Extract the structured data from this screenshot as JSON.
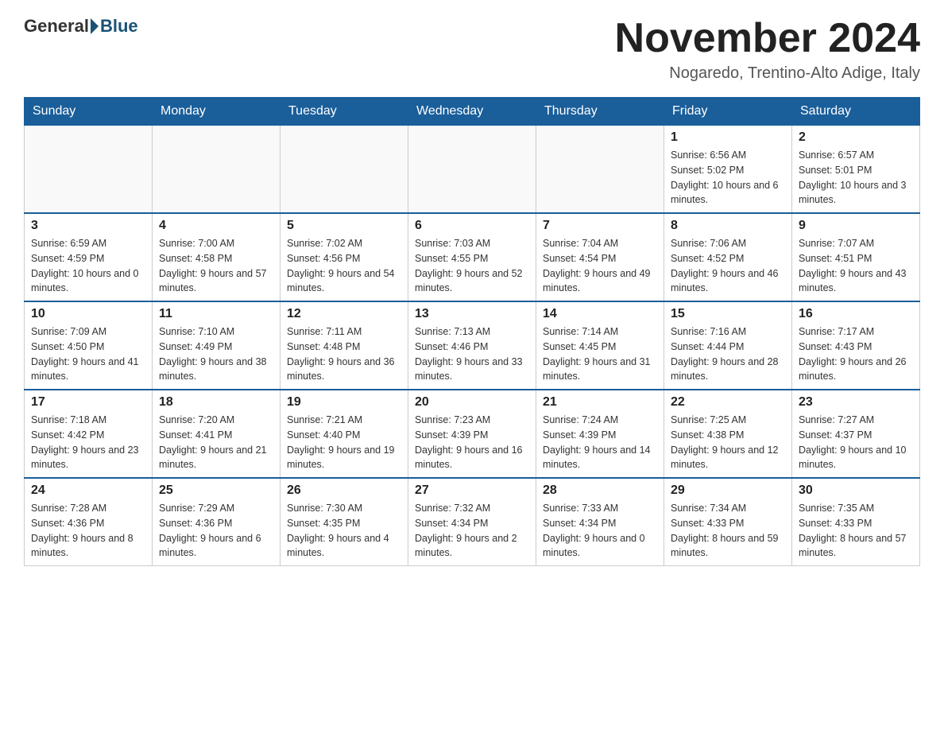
{
  "header": {
    "logo_general": "General",
    "logo_blue": "Blue",
    "month_year": "November 2024",
    "location": "Nogaredo, Trentino-Alto Adige, Italy"
  },
  "weekdays": [
    "Sunday",
    "Monday",
    "Tuesday",
    "Wednesday",
    "Thursday",
    "Friday",
    "Saturday"
  ],
  "weeks": [
    [
      {
        "day": "",
        "info": ""
      },
      {
        "day": "",
        "info": ""
      },
      {
        "day": "",
        "info": ""
      },
      {
        "day": "",
        "info": ""
      },
      {
        "day": "",
        "info": ""
      },
      {
        "day": "1",
        "info": "Sunrise: 6:56 AM\nSunset: 5:02 PM\nDaylight: 10 hours and 6 minutes."
      },
      {
        "day": "2",
        "info": "Sunrise: 6:57 AM\nSunset: 5:01 PM\nDaylight: 10 hours and 3 minutes."
      }
    ],
    [
      {
        "day": "3",
        "info": "Sunrise: 6:59 AM\nSunset: 4:59 PM\nDaylight: 10 hours and 0 minutes."
      },
      {
        "day": "4",
        "info": "Sunrise: 7:00 AM\nSunset: 4:58 PM\nDaylight: 9 hours and 57 minutes."
      },
      {
        "day": "5",
        "info": "Sunrise: 7:02 AM\nSunset: 4:56 PM\nDaylight: 9 hours and 54 minutes."
      },
      {
        "day": "6",
        "info": "Sunrise: 7:03 AM\nSunset: 4:55 PM\nDaylight: 9 hours and 52 minutes."
      },
      {
        "day": "7",
        "info": "Sunrise: 7:04 AM\nSunset: 4:54 PM\nDaylight: 9 hours and 49 minutes."
      },
      {
        "day": "8",
        "info": "Sunrise: 7:06 AM\nSunset: 4:52 PM\nDaylight: 9 hours and 46 minutes."
      },
      {
        "day": "9",
        "info": "Sunrise: 7:07 AM\nSunset: 4:51 PM\nDaylight: 9 hours and 43 minutes."
      }
    ],
    [
      {
        "day": "10",
        "info": "Sunrise: 7:09 AM\nSunset: 4:50 PM\nDaylight: 9 hours and 41 minutes."
      },
      {
        "day": "11",
        "info": "Sunrise: 7:10 AM\nSunset: 4:49 PM\nDaylight: 9 hours and 38 minutes."
      },
      {
        "day": "12",
        "info": "Sunrise: 7:11 AM\nSunset: 4:48 PM\nDaylight: 9 hours and 36 minutes."
      },
      {
        "day": "13",
        "info": "Sunrise: 7:13 AM\nSunset: 4:46 PM\nDaylight: 9 hours and 33 minutes."
      },
      {
        "day": "14",
        "info": "Sunrise: 7:14 AM\nSunset: 4:45 PM\nDaylight: 9 hours and 31 minutes."
      },
      {
        "day": "15",
        "info": "Sunrise: 7:16 AM\nSunset: 4:44 PM\nDaylight: 9 hours and 28 minutes."
      },
      {
        "day": "16",
        "info": "Sunrise: 7:17 AM\nSunset: 4:43 PM\nDaylight: 9 hours and 26 minutes."
      }
    ],
    [
      {
        "day": "17",
        "info": "Sunrise: 7:18 AM\nSunset: 4:42 PM\nDaylight: 9 hours and 23 minutes."
      },
      {
        "day": "18",
        "info": "Sunrise: 7:20 AM\nSunset: 4:41 PM\nDaylight: 9 hours and 21 minutes."
      },
      {
        "day": "19",
        "info": "Sunrise: 7:21 AM\nSunset: 4:40 PM\nDaylight: 9 hours and 19 minutes."
      },
      {
        "day": "20",
        "info": "Sunrise: 7:23 AM\nSunset: 4:39 PM\nDaylight: 9 hours and 16 minutes."
      },
      {
        "day": "21",
        "info": "Sunrise: 7:24 AM\nSunset: 4:39 PM\nDaylight: 9 hours and 14 minutes."
      },
      {
        "day": "22",
        "info": "Sunrise: 7:25 AM\nSunset: 4:38 PM\nDaylight: 9 hours and 12 minutes."
      },
      {
        "day": "23",
        "info": "Sunrise: 7:27 AM\nSunset: 4:37 PM\nDaylight: 9 hours and 10 minutes."
      }
    ],
    [
      {
        "day": "24",
        "info": "Sunrise: 7:28 AM\nSunset: 4:36 PM\nDaylight: 9 hours and 8 minutes."
      },
      {
        "day": "25",
        "info": "Sunrise: 7:29 AM\nSunset: 4:36 PM\nDaylight: 9 hours and 6 minutes."
      },
      {
        "day": "26",
        "info": "Sunrise: 7:30 AM\nSunset: 4:35 PM\nDaylight: 9 hours and 4 minutes."
      },
      {
        "day": "27",
        "info": "Sunrise: 7:32 AM\nSunset: 4:34 PM\nDaylight: 9 hours and 2 minutes."
      },
      {
        "day": "28",
        "info": "Sunrise: 7:33 AM\nSunset: 4:34 PM\nDaylight: 9 hours and 0 minutes."
      },
      {
        "day": "29",
        "info": "Sunrise: 7:34 AM\nSunset: 4:33 PM\nDaylight: 8 hours and 59 minutes."
      },
      {
        "day": "30",
        "info": "Sunrise: 7:35 AM\nSunset: 4:33 PM\nDaylight: 8 hours and 57 minutes."
      }
    ]
  ]
}
